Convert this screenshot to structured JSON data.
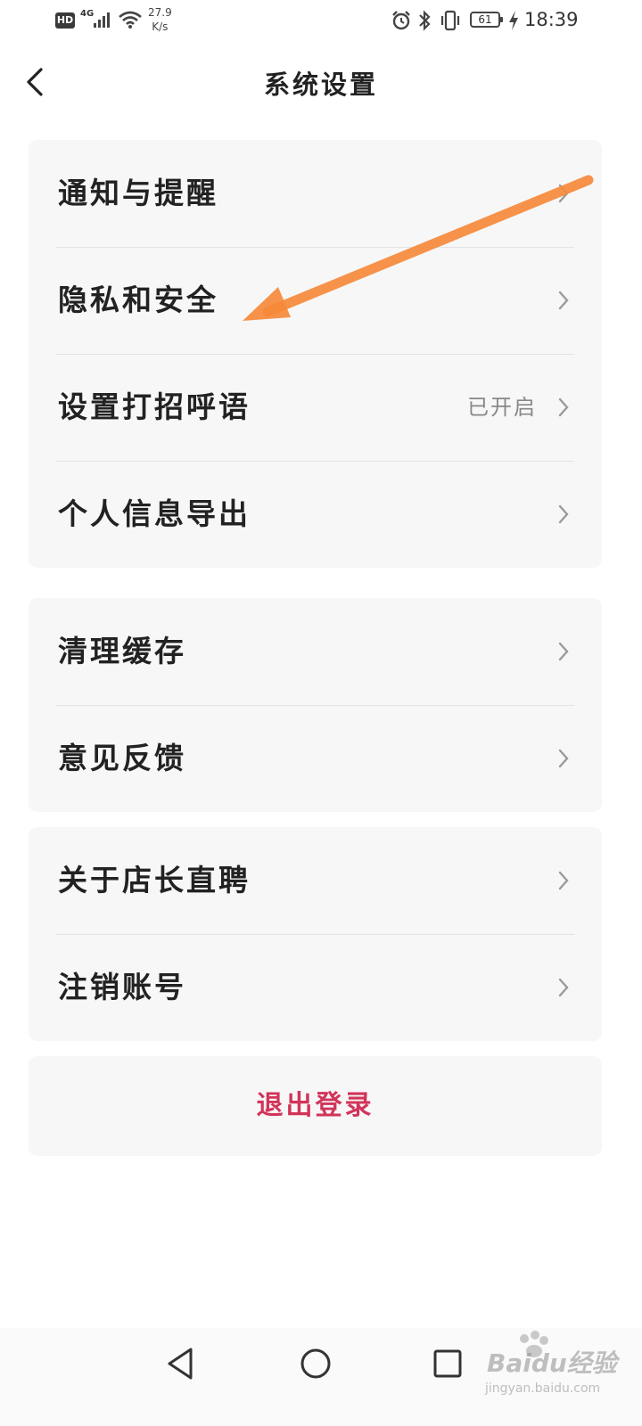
{
  "status_bar": {
    "hd": "HD",
    "network_type": "4G",
    "speed_value": "27.9",
    "speed_unit": "K/s",
    "battery": "61",
    "time": "18:39"
  },
  "header": {
    "title": "系统设置",
    "back_icon": "chevron-left-icon"
  },
  "groups": [
    {
      "items": [
        {
          "label": "通知与提醒",
          "value": ""
        },
        {
          "label": "隐私和安全",
          "value": ""
        },
        {
          "label": "设置打招呼语",
          "value": "已开启"
        },
        {
          "label": "个人信息导出",
          "value": ""
        }
      ]
    },
    {
      "items": [
        {
          "label": "清理缓存",
          "value": ""
        },
        {
          "label": "意见反馈",
          "value": ""
        }
      ]
    },
    {
      "items": [
        {
          "label": "关于店长直聘",
          "value": ""
        },
        {
          "label": "注销账号",
          "value": ""
        }
      ]
    }
  ],
  "logout_label": "退出登录",
  "colors": {
    "logout": "#d2345a",
    "card_bg": "#f7f7f7",
    "annotation_arrow": "#f5893a"
  },
  "watermark": {
    "brand": "Baidu经验",
    "url": "jingyan.baidu.com"
  }
}
